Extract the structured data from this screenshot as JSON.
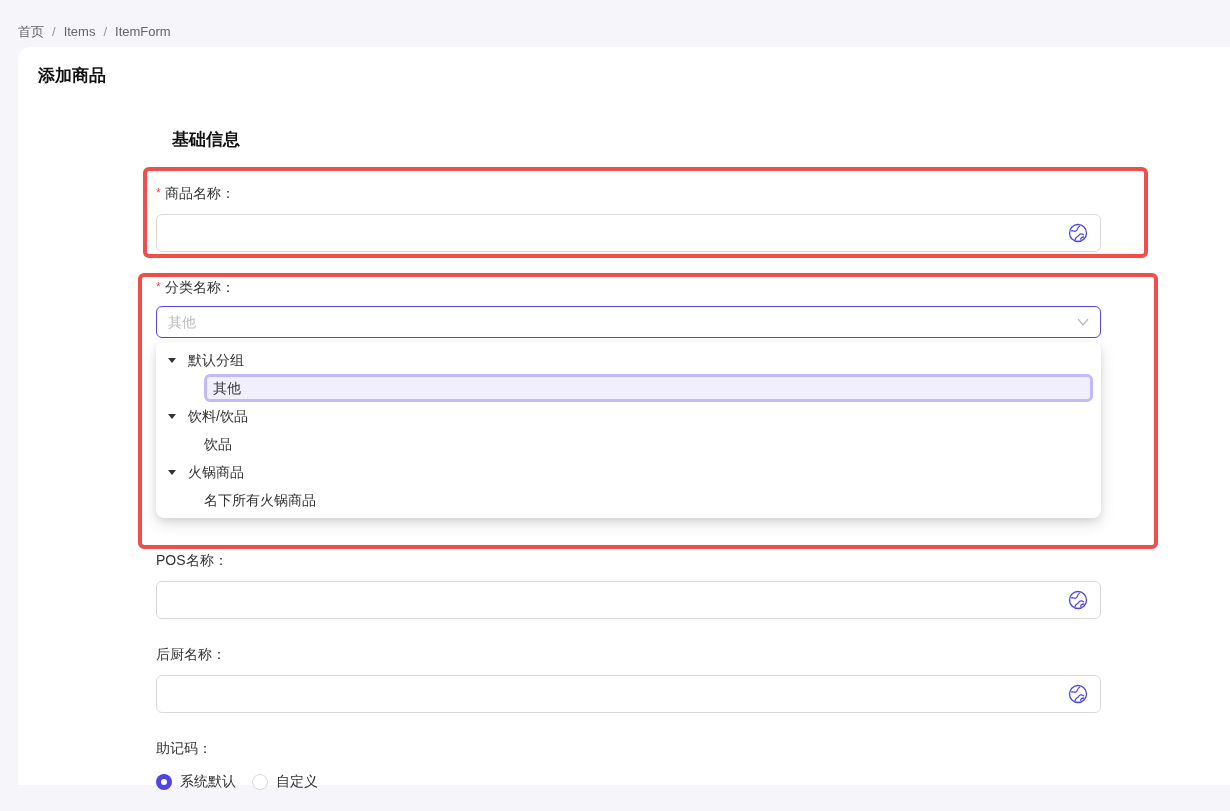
{
  "breadcrumb": [
    {
      "label": "首页"
    },
    {
      "separator": "/",
      "label": "Items"
    },
    {
      "separator": "/",
      "label": "ItemForm"
    }
  ],
  "page_title": "添加商品",
  "section_title": "基础信息",
  "fields": [
    {
      "kind": "text",
      "label": "商品名称：",
      "required_mark": "*",
      "translate_icon": true
    },
    {
      "kind": "tree_select",
      "label": "分类名称：",
      "required_mark": "*",
      "placeholder": "其他",
      "focused": true,
      "expanded": true,
      "options": [
        {
          "label": "默认分组",
          "expanded": true,
          "selected": false,
          "children": [
            {
              "label": "其他",
              "selected": true
            }
          ]
        },
        {
          "label": "饮料/饮品",
          "expanded": true,
          "selected": false,
          "children": [
            {
              "label": "饮品",
              "selected": false
            }
          ]
        },
        {
          "label": "火锅商品",
          "expanded": true,
          "selected": false,
          "children": [
            {
              "label": "名下所有火锅商品",
              "selected": false
            }
          ]
        }
      ]
    },
    {
      "kind": "text",
      "label": "POS名称：",
      "translate_icon": true
    },
    {
      "kind": "text",
      "label": "后厨名称：",
      "translate_icon": true
    },
    {
      "kind": "radio",
      "label": "助记码：",
      "options": [
        {
          "label": "系统默认",
          "selected": true
        },
        {
          "label": "自定义",
          "selected": false
        }
      ]
    }
  ]
}
